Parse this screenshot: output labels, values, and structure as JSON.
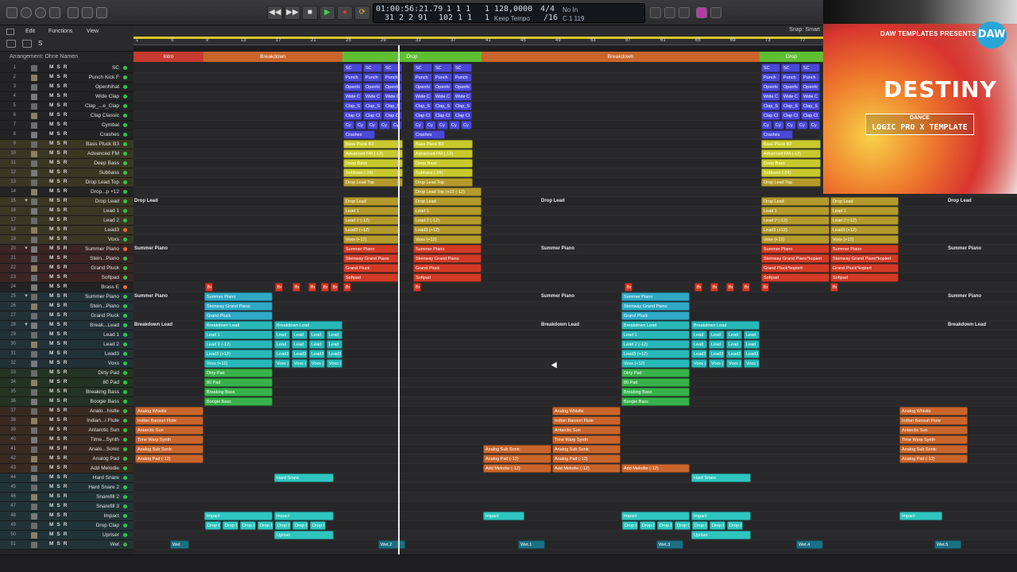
{
  "transport": {
    "time": "01:00:56:21.79",
    "bars": "31  2  2  91",
    "sub_top": "1  1  1",
    "sub_bottom": "102  1  1",
    "sub2_top": "1",
    "sub2_bottom": "1",
    "tempo": "128,0000",
    "tempo_mode": "Keep Tempo",
    "signature": "4/4",
    "division": "/16",
    "in": "No In",
    "cpu": "C 1 119"
  },
  "menus": {
    "edit": "Edit",
    "functions": "Functions",
    "view": "View"
  },
  "snap": "Snap:  Smart",
  "arrangement_label": "Arrangement: Ohne Namen",
  "ruler": [
    "1",
    "5",
    "9",
    "13",
    "17",
    "21",
    "25",
    "29",
    "33",
    "37",
    "41",
    "45",
    "49",
    "53",
    "57",
    "61",
    "65",
    "69",
    "73",
    "77"
  ],
  "markers": [
    {
      "label": "Intro",
      "color": "#c73a2f"
    },
    {
      "label": "Breakdown",
      "color": "#c9652b"
    },
    {
      "label": "Drop",
      "color": "#5fbf33"
    },
    {
      "label": "Breakdown",
      "color": "#c9652b"
    },
    {
      "label": "Drop",
      "color": "#5fbf33"
    }
  ],
  "tracks": [
    {
      "n": "1",
      "name": "SC"
    },
    {
      "n": "2",
      "name": "Punch Kick F"
    },
    {
      "n": "3",
      "name": "Openhihat"
    },
    {
      "n": "4",
      "name": "Wide Clap"
    },
    {
      "n": "5",
      "name": "Clap_...e_Clap"
    },
    {
      "n": "6",
      "name": "Clap Classic"
    },
    {
      "n": "7",
      "name": "Cymbal"
    },
    {
      "n": "8",
      "name": "Crashes"
    },
    {
      "n": "9",
      "name": "Bass Pluck B3"
    },
    {
      "n": "10",
      "name": "Advanced FM"
    },
    {
      "n": "11",
      "name": "Deep Bass"
    },
    {
      "n": "12",
      "name": "Subbass"
    },
    {
      "n": "13",
      "name": "Drop Lead Top"
    },
    {
      "n": "14",
      "name": "Drop...p +12"
    },
    {
      "n": "15",
      "name": "Drop Lead"
    },
    {
      "n": "16",
      "name": "Lead 1"
    },
    {
      "n": "17",
      "name": "Lead 2"
    },
    {
      "n": "18",
      "name": "Lead3"
    },
    {
      "n": "19",
      "name": "Voxs"
    },
    {
      "n": "20",
      "name": "Summer Piano"
    },
    {
      "n": "21",
      "name": "Stein...Piano"
    },
    {
      "n": "22",
      "name": "Grand Pluck"
    },
    {
      "n": "23",
      "name": "Softpad"
    },
    {
      "n": "24",
      "name": "Brass E"
    },
    {
      "n": "25",
      "name": "Summer Piano"
    },
    {
      "n": "26",
      "name": "Stein...Piano"
    },
    {
      "n": "27",
      "name": "Grand Pluck"
    },
    {
      "n": "28",
      "name": "Break...Lead"
    },
    {
      "n": "29",
      "name": "Lead 1"
    },
    {
      "n": "30",
      "name": "Lead 2"
    },
    {
      "n": "31",
      "name": "Lead3"
    },
    {
      "n": "32",
      "name": "Voxs"
    },
    {
      "n": "33",
      "name": "Dirty Pad"
    },
    {
      "n": "34",
      "name": "80 Pad"
    },
    {
      "n": "35",
      "name": "Breaking Bass"
    },
    {
      "n": "36",
      "name": "Boogie Bass"
    },
    {
      "n": "37",
      "name": "Analo...histle"
    },
    {
      "n": "38",
      "name": "Indian...i Flute"
    },
    {
      "n": "39",
      "name": "Antarctic Sun"
    },
    {
      "n": "40",
      "name": "Time...Synth"
    },
    {
      "n": "41",
      "name": "Analo...Sonic"
    },
    {
      "n": "42",
      "name": "Analog Pad"
    },
    {
      "n": "43",
      "name": "Add Melodie"
    },
    {
      "n": "44",
      "name": "Hard Snare"
    },
    {
      "n": "45",
      "name": "Hard Snare 2"
    },
    {
      "n": "46",
      "name": "Snarefill 2"
    },
    {
      "n": "47",
      "name": "Snarefill 3"
    },
    {
      "n": "48",
      "name": "Impact"
    },
    {
      "n": "49",
      "name": "Drop Clap"
    },
    {
      "n": "50",
      "name": "Upriser"
    },
    {
      "n": "51",
      "name": "Wet"
    }
  ],
  "lane_labels": {
    "drop_lead": "Drop Lead",
    "summer_piano": "Summer Piano",
    "breakdown_lead": "Breakdown Lead"
  },
  "regions": {
    "sc": "SC",
    "punch": "Punch",
    "openhi": "Openhi",
    "wide": "Wide C",
    "clap_s": "Clap_S",
    "clap_cl": "Clap Cl",
    "cy": "Cy",
    "crashes": "Crashes",
    "bass_pluck": "Bass Pluck B3",
    "adv_fm": "Advanced FM (-12)",
    "deep_bass": "Deep Bass",
    "subbass": "Subbass (-24)",
    "drop_lead_top": "Drop Lead Top",
    "drop_lead_top12": "Drop Lead Top (+12 (-12)",
    "drop_lead": "Drop Lead",
    "lead1": "Lead 1",
    "lead2": "Lead 2 (-12)",
    "lead3": "Lead3 (+12)",
    "voxs": "Voxs (+12)",
    "summer_piano": "Summer Piano",
    "steinway": "Steinway Grand Piano",
    "steinway_k": "Steinway Grand Piano*kopiert",
    "grand_pluck": "Grand Pluck",
    "grand_pluck_k": "Grand Pluck*kopiert",
    "softpad": "Softpad",
    "br": "Br",
    "breakdown_lead": "Breakdown Lead",
    "lead2b": "Lead 2 (-12)",
    "lead3b": "Lead3 (+12)",
    "lead_s": "Lead",
    "lead3_s": "Lead3 (-1",
    "dirty_pad": "Dirty Pad",
    "pad80": "80 Pad",
    "breaking_bass": "Breaking Bass",
    "boogie_bass": "Boogie Bass",
    "analog_whistle": "Analog Whistle",
    "indian_flute": "Indian Bansuri Flute",
    "antarctic_sun": "Antarctic Sun",
    "time_warp": "Time Warp Synth",
    "analog_sub": "Analog Sub Sonic",
    "analog_pad": "Analog Pad (-12)",
    "add_melodie": "Add Melodie (-12)",
    "hard_snare": "Hard Snare",
    "impact": "Impact",
    "drop_clap": "Drop Cl",
    "upriser": "Upriser",
    "wet": "Wet",
    "wet2": "Wet.2",
    "wet1": "Wet.1",
    "wet3": "Wet.3",
    "wet4": "Wet.4",
    "wet5": "Wet.5"
  },
  "promo": {
    "brand": "DAW TEMPLATES PRESENTS",
    "logo": "DAW",
    "title": "DESTINY",
    "subtitle": "DANCE",
    "subtitle2": "LOGIC PRO X TEMPLATE"
  },
  "colors": {
    "blue": "#4b48d8",
    "yellow": "#c7c92c",
    "gold": "#b49a2a",
    "red": "#d23a25",
    "teal": "#2fa9c6",
    "cyan": "#28b8b8",
    "green": "#37b24b",
    "orange": "#c9652b",
    "aqua": "#2fc6c0",
    "cycle": "#d7c52a"
  }
}
